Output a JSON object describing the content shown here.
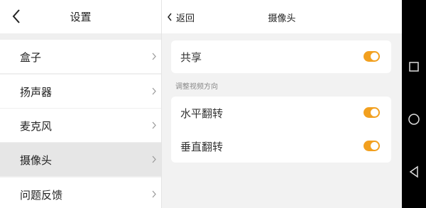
{
  "left": {
    "title": "设置",
    "items": [
      {
        "label": "盒子"
      },
      {
        "label": "扬声器"
      },
      {
        "label": "麦克风"
      },
      {
        "label": "摄像头"
      },
      {
        "label": "问题反馈"
      }
    ]
  },
  "right": {
    "back_label": "返回",
    "title": "摄像头",
    "share_label": "共享",
    "section_label": "调整视频方向",
    "horizontal_flip_label": "水平翻转",
    "vertical_flip_label": "垂直翻转"
  },
  "toggles": {
    "share_on": true,
    "horizontal_flip_on": true,
    "vertical_flip_on": true,
    "accent_color": "#f2a01f"
  },
  "icons": {
    "back": "back-arrow-icon",
    "chevron": "chevron-right-icon",
    "nav_recents": "square-icon",
    "nav_home": "circle-icon",
    "nav_back": "triangle-back-icon"
  }
}
